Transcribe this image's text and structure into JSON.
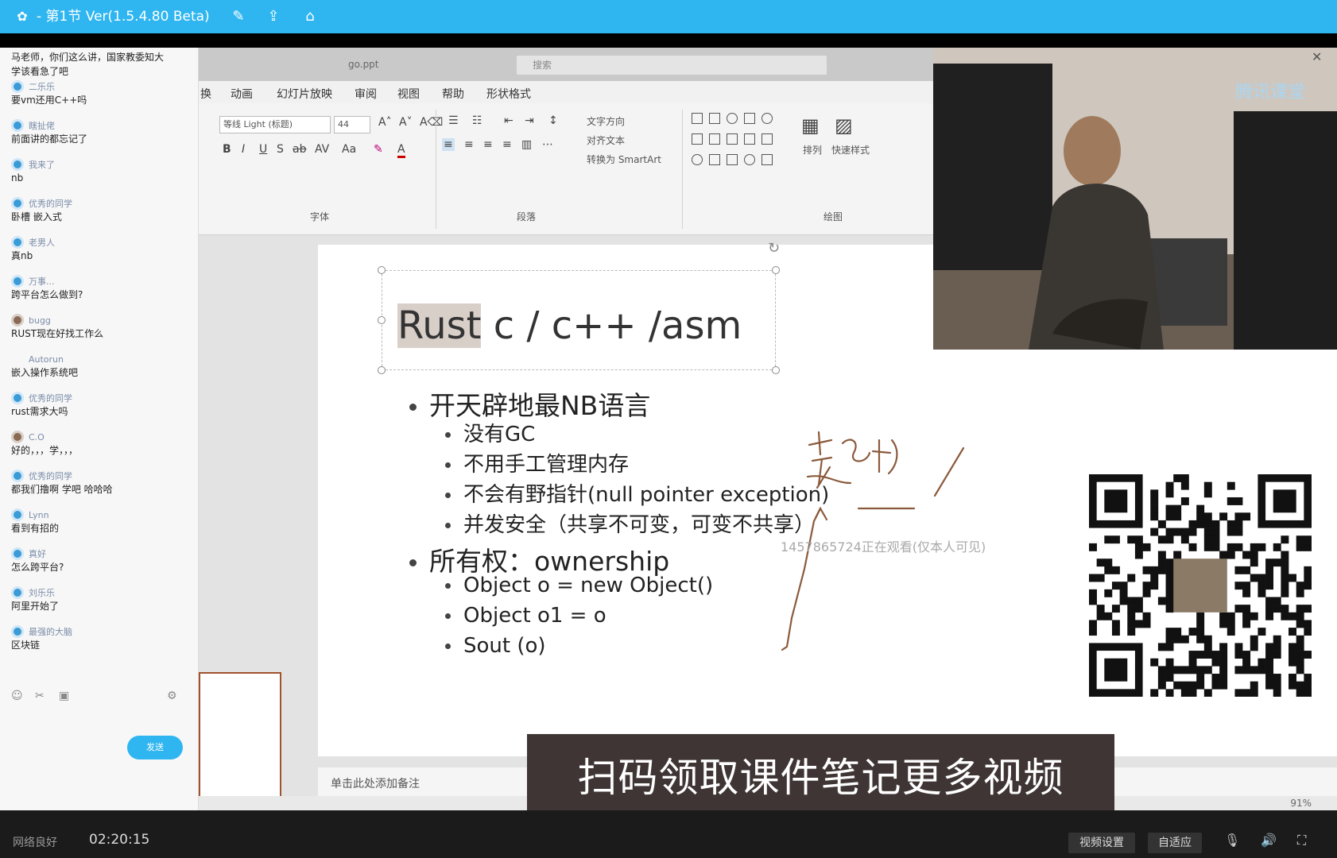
{
  "titlebar": {
    "title": "- 第1节 Ver(1.5.4.80 Beta)",
    "icons": [
      "edit-icon",
      "share-icon",
      "home-icon"
    ],
    "window_controls": [
      "minimize-icon",
      "maximize-icon",
      "close-icon"
    ]
  },
  "chat": {
    "messages": [
      {
        "name": "",
        "text": "马老师，你们这么讲，国家教委知大"
      },
      {
        "name": "",
        "text": "学该看急了吧"
      },
      {
        "name": "二乐乐",
        "text": "要vm还用C++吗"
      },
      {
        "name": "瞎扯佬",
        "text": "前面讲的都忘记了"
      },
      {
        "name": "我来了",
        "text": "nb"
      },
      {
        "name": "优秀的同学",
        "text": "卧槽 嵌入式"
      },
      {
        "name": "老男人",
        "text": "真nb"
      },
      {
        "name": "万事...",
        "text": "跨平台怎么做到?"
      },
      {
        "name": "bugg",
        "text": "RUST现在好找工作么"
      },
      {
        "name": "Autorun",
        "text": "嵌入操作系统吧"
      },
      {
        "name": "优秀的同学",
        "text": "rust需求大吗"
      },
      {
        "name": "C.O",
        "text": "好的，，，学，，，"
      },
      {
        "name": "优秀的同学",
        "text": "都我们撸啊 学吧 哈哈哈"
      },
      {
        "name": "Lynn",
        "text": "看到有招的"
      },
      {
        "name": "真好",
        "text": "怎么跨平台?"
      },
      {
        "name": "刘乐乐",
        "text": "阿里开始了"
      },
      {
        "name": "最强的大脑",
        "text": "区块链"
      }
    ],
    "send_label": "发送"
  },
  "ppt": {
    "filename": "go.ppt",
    "search_placeholder": "搜索",
    "tabs": [
      "换",
      "动画",
      "幻灯片放映",
      "审阅",
      "视图",
      "帮助",
      "形状格式"
    ],
    "font_name": "等线 Light (标题)",
    "font_size": "44",
    "group_font": "字体",
    "group_paragraph": "段落",
    "group_drawing": "绘图",
    "text_direction": "文字方向",
    "align_text": "对齐文本",
    "convert_smartart": "转换为 SmartArt",
    "arrange": "排列",
    "quick_styles": "快速样式",
    "notes_placeholder": "单击此处添加备注",
    "zoom": "91%"
  },
  "slide": {
    "title_highlight": "Rust",
    "title_rest": " c / c++ /asm",
    "bullets": [
      {
        "level": 1,
        "text": "开天辟地最NB语言"
      },
      {
        "level": 2,
        "text": "没有GC"
      },
      {
        "level": 2,
        "text": "不用手工管理内存"
      },
      {
        "level": 2,
        "text": "不会有野指针(null pointer exception)"
      },
      {
        "level": 2,
        "text": "并发安全（共享不可变，可变不共享）"
      },
      {
        "level": 1,
        "text": "所有权：ownership"
      },
      {
        "level": 2,
        "text": "Object o = new Object()"
      },
      {
        "level": 2,
        "text": "Object o1 = o"
      },
      {
        "level": 2,
        "text": "Sout (o)"
      }
    ],
    "handwriting": "超"
  },
  "overlay": {
    "cam_brand": "腾讯课堂",
    "watermark": "1457865724正在观看(仅本人可见)",
    "banner": "扫码领取课件笔记更多视频"
  },
  "bottombar": {
    "network": "网络良好",
    "time": "02:20:15",
    "video_settings": "视频设置",
    "fit": "自适应"
  },
  "colors": {
    "accent": "#2fb6f0",
    "banner_bg": "#3f3535",
    "ink": "#8b5a3c"
  }
}
